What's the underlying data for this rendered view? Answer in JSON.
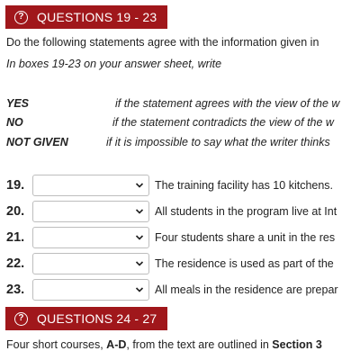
{
  "section1": {
    "title": "QUESTIONS 19 - 23",
    "icon": "question-circle-icon",
    "instruction": "Do the following statements agree with the information given in",
    "boxes_instruction": "In boxes 19-23 on your answer sheet, write"
  },
  "key": [
    {
      "term": "YES",
      "desc": "if the statement agrees with the view of the w"
    },
    {
      "term": "NO",
      "desc": "if the statement contradicts the view of the w"
    },
    {
      "term": "NOT GIVEN",
      "desc": "if it is impossible to say what the writer thinks"
    }
  ],
  "questions": [
    {
      "num": "19.",
      "text": "The training facility has 10 kitchens.",
      "selected": ""
    },
    {
      "num": "20.",
      "text": "All students in the program live at Int",
      "selected": ""
    },
    {
      "num": "21.",
      "text": "Four students share a unit in the res",
      "selected": ""
    },
    {
      "num": "22.",
      "text": "The residence is used as part of the",
      "selected": ""
    },
    {
      "num": "23.",
      "text": "All meals in the residence are prepar",
      "selected": ""
    }
  ],
  "section2": {
    "title": "QUESTIONS 24 - 27",
    "icon": "question-circle-icon",
    "intro_pre": "Four short courses,",
    "intro_bold1": "A-D",
    "intro_mid": ", from the text are outlined in",
    "intro_bold2": "Section 3"
  },
  "colors": {
    "banner": "#a0171b",
    "select_border": "#bdbdbd"
  }
}
